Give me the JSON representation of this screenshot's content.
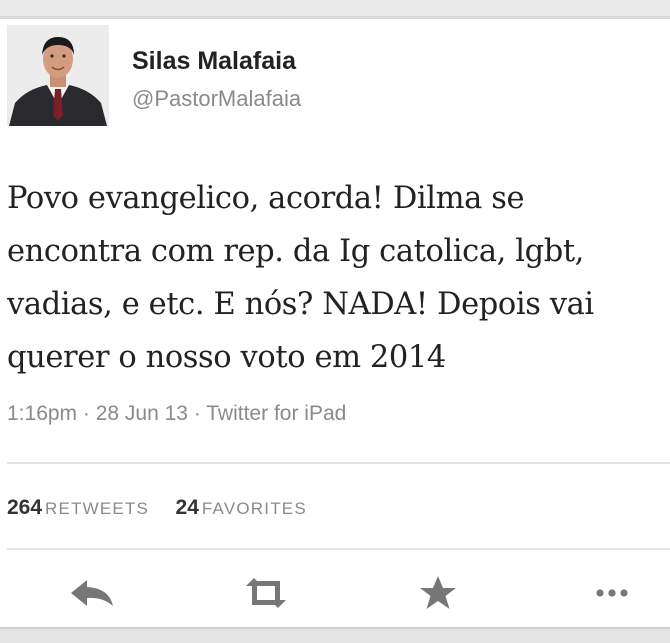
{
  "author": {
    "name": "Silas Malafaia",
    "handle": "@PastorMalafaia",
    "avatar_icon": "profile-photo"
  },
  "tweet": {
    "lines": [
      "Povo evangelico, acorda! Dilma se",
      "encontra com rep. da Ig catolica, lgbt,",
      "vadias, e etc. E nós? NADA! Depois vai",
      "querer o nosso voto em 2014"
    ]
  },
  "meta": {
    "time": "1:16pm",
    "date": "28 Jun 13",
    "source": "Twitter for iPad"
  },
  "stats": {
    "retweets_count": "264",
    "retweets_label": "RETWEETS",
    "favorites_count": "24",
    "favorites_label": "FAVORITES"
  },
  "actions": {
    "reply_icon": "reply-icon",
    "retweet_icon": "retweet-icon",
    "favorite_icon": "star-icon",
    "more_icon": "more-icon"
  },
  "colors": {
    "text": "#222222",
    "muted": "#8a8a8a",
    "icon": "#777777"
  }
}
